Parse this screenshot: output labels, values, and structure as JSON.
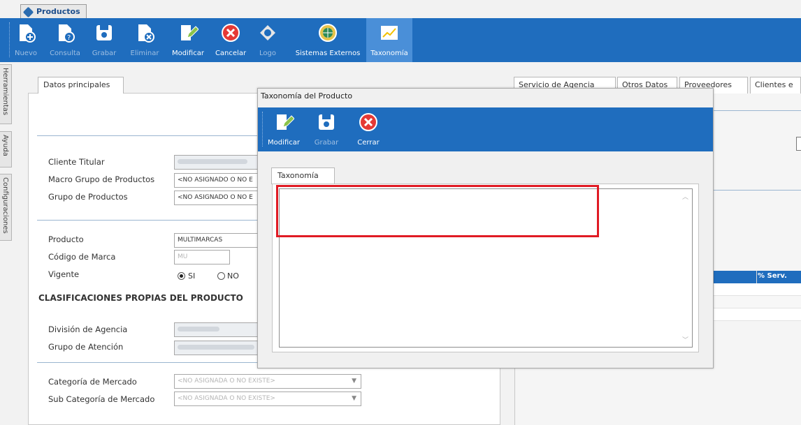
{
  "window_tab": {
    "label": "Productos"
  },
  "toolbar": {
    "buttons": [
      {
        "label": "Nuevo",
        "icon": "new-doc-icon",
        "enabled": false
      },
      {
        "label": "Consulta",
        "icon": "query-doc-icon",
        "enabled": false
      },
      {
        "label": "Grabar",
        "icon": "save-icon",
        "enabled": false
      },
      {
        "label": "Eliminar",
        "icon": "delete-doc-icon",
        "enabled": false
      },
      {
        "label": "Modificar",
        "icon": "edit-doc-icon",
        "enabled": true
      },
      {
        "label": "Cancelar",
        "icon": "cancel-icon",
        "enabled": true
      },
      {
        "label": "Logo",
        "icon": "logo-icon",
        "enabled": false
      },
      {
        "label": "Sistemas Externos",
        "icon": "globe-icon",
        "enabled": true
      },
      {
        "label": "Taxonomía",
        "icon": "chart-icon",
        "enabled": true,
        "active": true
      }
    ]
  },
  "side_tabs": [
    "Herramientas",
    "Ayuda",
    "Configuraciones"
  ],
  "main": {
    "tab": "Datos principales",
    "fields": {
      "cliente_titular": {
        "label": "Cliente Titular"
      },
      "macro_grupo": {
        "label": "Macro Grupo de Productos",
        "value": "<NO ASIGNADO O NO E"
      },
      "grupo_productos": {
        "label": "Grupo de Productos",
        "value": "<NO ASIGNADO O NO E"
      },
      "producto": {
        "label": "Producto",
        "value": "MULTIMARCAS"
      },
      "codigo_marca": {
        "label": "Código de Marca",
        "value": "MU"
      },
      "vigente": {
        "label": "Vigente",
        "options": [
          "SI",
          "NO"
        ],
        "selected": "SI"
      }
    },
    "section_title": "CLASIFICACIONES PROPIAS DEL PRODUCTO",
    "fields2": {
      "division": {
        "label": "División de Agencia"
      },
      "grupo_atencion": {
        "label": "Grupo de Atención"
      },
      "categoria": {
        "label": "Categoría de Mercado",
        "value": "<NO ASIGNADA O NO EXISTE>"
      },
      "subcategoria": {
        "label": "Sub Categoría de Mercado",
        "value": "<NO ASIGNADA O NO EXISTE>"
      }
    }
  },
  "right": {
    "tabs": [
      "Servicio de Agencia",
      "Otros Datos",
      "Proveedores",
      "Clientes e"
    ],
    "grid_header": "% Serv."
  },
  "modal": {
    "title": "Taxonomía del Producto",
    "buttons": [
      {
        "label": "Modificar",
        "icon": "edit-doc-icon",
        "enabled": true
      },
      {
        "label": "Grabar",
        "icon": "save-icon",
        "enabled": false
      },
      {
        "label": "Cerrar",
        "icon": "close-icon",
        "enabled": true
      }
    ],
    "tab": "Taxonomía",
    "text_value": ""
  },
  "colors": {
    "toolbar": "#1f6dbe",
    "highlight": "#e01b24"
  }
}
